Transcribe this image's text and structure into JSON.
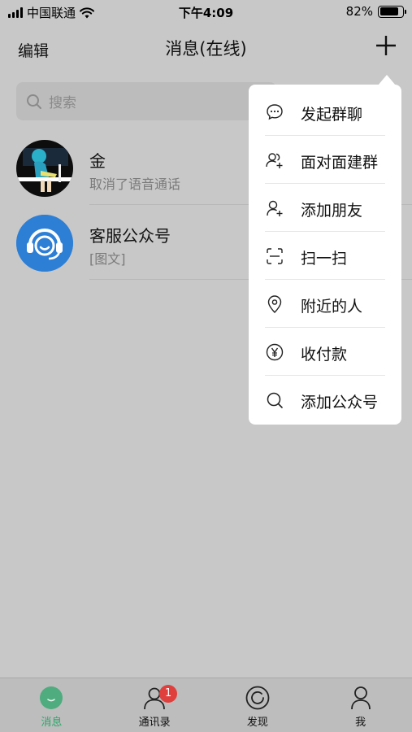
{
  "status_bar": {
    "carrier": "中国联通",
    "time": "下午4:09",
    "battery_percent": "82%",
    "battery_level": 0.82
  },
  "nav": {
    "edit_label": "编辑",
    "title": "消息(在线)",
    "plus_icon": "plus-icon"
  },
  "search": {
    "placeholder": "搜索"
  },
  "conversations": [
    {
      "name": "金",
      "subtitle": "取消了语音通话",
      "avatar": "illustration-avatar"
    },
    {
      "name": "客服公众号",
      "subtitle": "[图文]",
      "avatar": "headset-avatar",
      "avatar_color": "#2d7fd6"
    }
  ],
  "popup_menu": {
    "items": [
      {
        "label": "发起群聊",
        "icon": "chat-bubble-icon"
      },
      {
        "label": "面对面建群",
        "icon": "group-add-icon"
      },
      {
        "label": "添加朋友",
        "icon": "user-add-icon"
      },
      {
        "label": "扫一扫",
        "icon": "scan-icon"
      },
      {
        "label": "附近的人",
        "icon": "location-pin-icon"
      },
      {
        "label": "收付款",
        "icon": "yen-icon"
      },
      {
        "label": "添加公众号",
        "icon": "search-icon"
      }
    ]
  },
  "tab_bar": {
    "tabs": [
      {
        "label": "消息",
        "icon": "chat-icon",
        "active": true
      },
      {
        "label": "通讯录",
        "icon": "contacts-icon",
        "badge": "1"
      },
      {
        "label": "发现",
        "icon": "discover-icon"
      },
      {
        "label": "我",
        "icon": "me-icon"
      }
    ]
  },
  "colors": {
    "accent_green": "#2aa76a",
    "badge_red": "#e0403d",
    "overlay_bg": "#c8c8c8"
  }
}
